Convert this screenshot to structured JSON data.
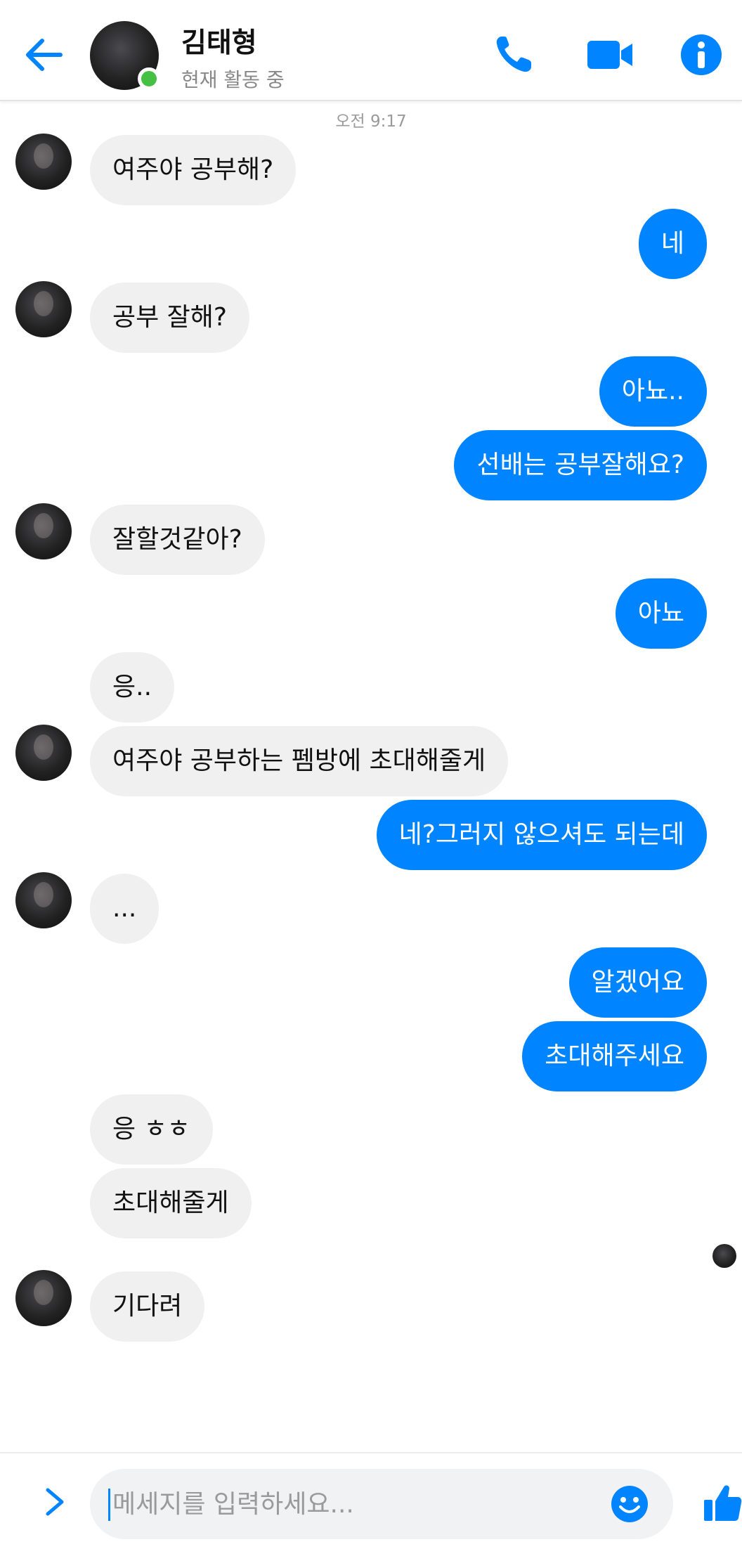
{
  "header": {
    "name": "김태형",
    "status": "현재 활동 중",
    "accent": "#0084ff",
    "online_color": "#44c043"
  },
  "timestamp": "오전 9:17",
  "messages": [
    {
      "dir": "in",
      "text": "여주야 공부해?"
    },
    {
      "dir": "out",
      "text": "네"
    },
    {
      "dir": "in",
      "text": "공부 잘해?"
    },
    {
      "dir": "out",
      "text": "아뇨.."
    },
    {
      "dir": "out",
      "text": "선배는 공부잘해요?"
    },
    {
      "dir": "in",
      "text": "잘할것같아?"
    },
    {
      "dir": "out",
      "text": "아뇨"
    },
    {
      "dir": "in",
      "text": "응.."
    },
    {
      "dir": "in",
      "text": "여주야 공부하는 펨방에 초대해줄게"
    },
    {
      "dir": "out",
      "text": "네?그러지 않으셔도 되는데"
    },
    {
      "dir": "in",
      "text": "..."
    },
    {
      "dir": "out",
      "text": "알겠어요"
    },
    {
      "dir": "out",
      "text": "초대해주세요"
    },
    {
      "dir": "in",
      "text": "응 ㅎㅎ"
    },
    {
      "dir": "in",
      "text": "초대해줄게"
    },
    {
      "dir": "in",
      "text": "기다려"
    }
  ],
  "composer": {
    "placeholder": "메세지를 입력하세요..."
  }
}
